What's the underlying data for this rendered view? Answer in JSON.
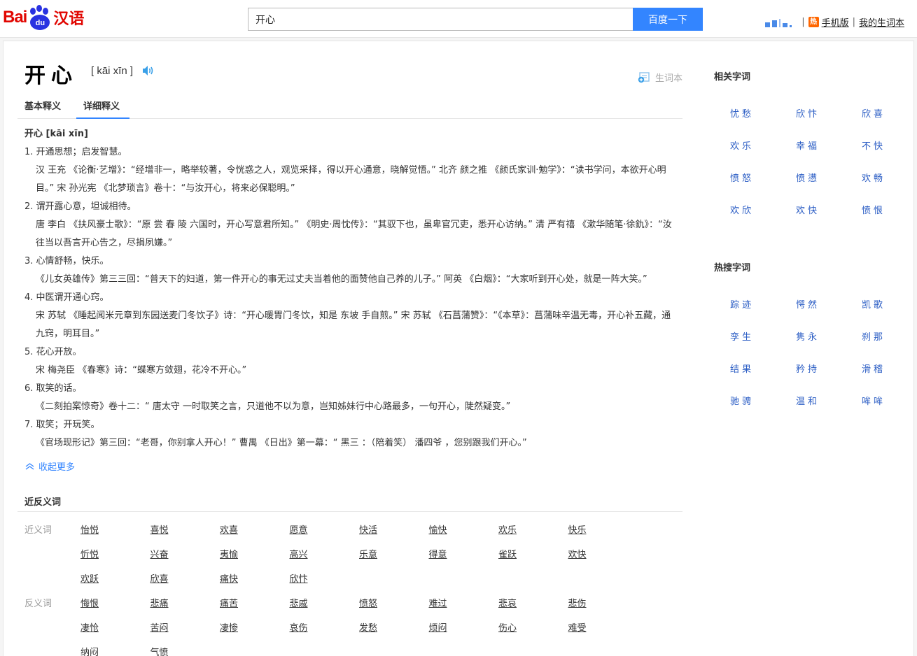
{
  "header": {
    "logo_text_bai": "Bai",
    "logo_text_du": "du",
    "logo_text_hanyu": "汉语",
    "search_value": "开心",
    "search_button": "百度一下",
    "mobile_badge": "热",
    "mobile_link": "手机版",
    "sep": "|",
    "my_vocab_link": "我的生词本"
  },
  "word": {
    "title": "开心",
    "pinyin": "[ kāi xīn ]",
    "vocab_button": "生词本"
  },
  "tabs": [
    "基本释义",
    "详细释义"
  ],
  "definitions": {
    "heading": "开心 [kāi xīn]",
    "items": [
      {
        "label": "1. 开通思想；启发智慧。",
        "examples": [
          "汉 王充 《论衡·艺增》：“经增非一，略举较著，令恍惑之人，观览采择，得以开心通意，晓解觉悟。” 北齐 颜之推 《颜氏家训·勉学》：“读书学问，本欲开心明目。” 宋 孙光宪 《北梦琐言》卷十：“与汝开心，将来必保聪明。”"
        ]
      },
      {
        "label": "2. 谓开露心意，坦诚相待。",
        "examples": [
          "唐 李白 《扶风豪士歌》：“原 尝 春 陵 六国时，开心写意君所知。” 《明史·周忱传》：“其驭下也，虽卑官冗吏，悉开心访纳。” 清 严有禧 《漱华随笔·徐釚》：“汝往当以吾言开心告之，尽捐夙嫌。”"
        ]
      },
      {
        "label": "3. 心情舒畅，快乐。",
        "examples": [
          "《儿女英雄传》第三三回：“普天下的妇道，第一件开心的事无过丈夫当着他的面赞他自己养的儿子。” 阿英 《白烟》：“大家听到开心处，就是一阵大笑。”"
        ]
      },
      {
        "label": "4. 中医谓开通心窍。",
        "examples": [
          "宋 苏轼 《睡起闻米元章到东园送麦门冬饮子》诗：“开心暖胃门冬饮，知是 东坡 手自煎。” 宋 苏轼 《石菖蒲赞》：“《本草》：菖蒲味辛温无毒，开心补五藏，通九窍，明耳目。”"
        ]
      },
      {
        "label": "5. 花心开放。",
        "examples": [
          "宋 梅尧臣 《春寒》诗：“蝶寒方敛翅，花冷不开心。”"
        ]
      },
      {
        "label": "6. 取笑的话。",
        "examples": [
          "《二刻拍案惊奇》卷十二：“ 唐太守 一时取笑之言，只道他不以为意，岂知姊妹行中心路最多，一句开心，陡然疑变。”"
        ]
      },
      {
        "label": "7. 取笑；开玩笑。",
        "examples": [
          "《官场现形记》第三回：“老哥，你别拿人开心！” 曹禺 《日出》第一幕：“ 黑三 ：（陪着笑） 潘四爷 ，您别跟我们开心。”"
        ]
      }
    ]
  },
  "collapse_label": "收起更多",
  "synonyms": {
    "title": "近反义词",
    "near_label": "近义词",
    "near_words": [
      "怡悦",
      "喜悦",
      "欢喜",
      "愿意",
      "快活",
      "愉快",
      "欢乐",
      "快乐",
      "忻悦",
      "兴奋",
      "夷愉",
      "高兴",
      "乐意",
      "得意",
      "雀跃",
      "欢快",
      "欢跃",
      "欣喜",
      "痛快",
      "欣忭"
    ],
    "anti_label": "反义词",
    "anti_words": [
      "悔恨",
      "悲痛",
      "痛苦",
      "悲戚",
      "愤怒",
      "难过",
      "悲哀",
      "悲伤",
      "凄怆",
      "苦闷",
      "凄惨",
      "哀伤",
      "发愁",
      "烦闷",
      "伤心",
      "难受",
      "纳闷",
      "气愤"
    ]
  },
  "related": {
    "title": "相关字词",
    "words": [
      "忧愁",
      "欣忭",
      "欣喜",
      "欢乐",
      "幸福",
      "不快",
      "愤怒",
      "愤懑",
      "欢畅",
      "欢欣",
      "欢快",
      "愤恨"
    ]
  },
  "hot": {
    "title": "热搜字词",
    "words": [
      "踪迹",
      "愕然",
      "凯歌",
      "孪生",
      "隽永",
      "刹那",
      "结果",
      "矜持",
      "滑稽",
      "驰骋",
      "温和",
      "哞哞"
    ]
  },
  "colors": {
    "accent": "#3385ff",
    "brand_red": "#e10601",
    "link_blue": "#2a5cc4"
  }
}
